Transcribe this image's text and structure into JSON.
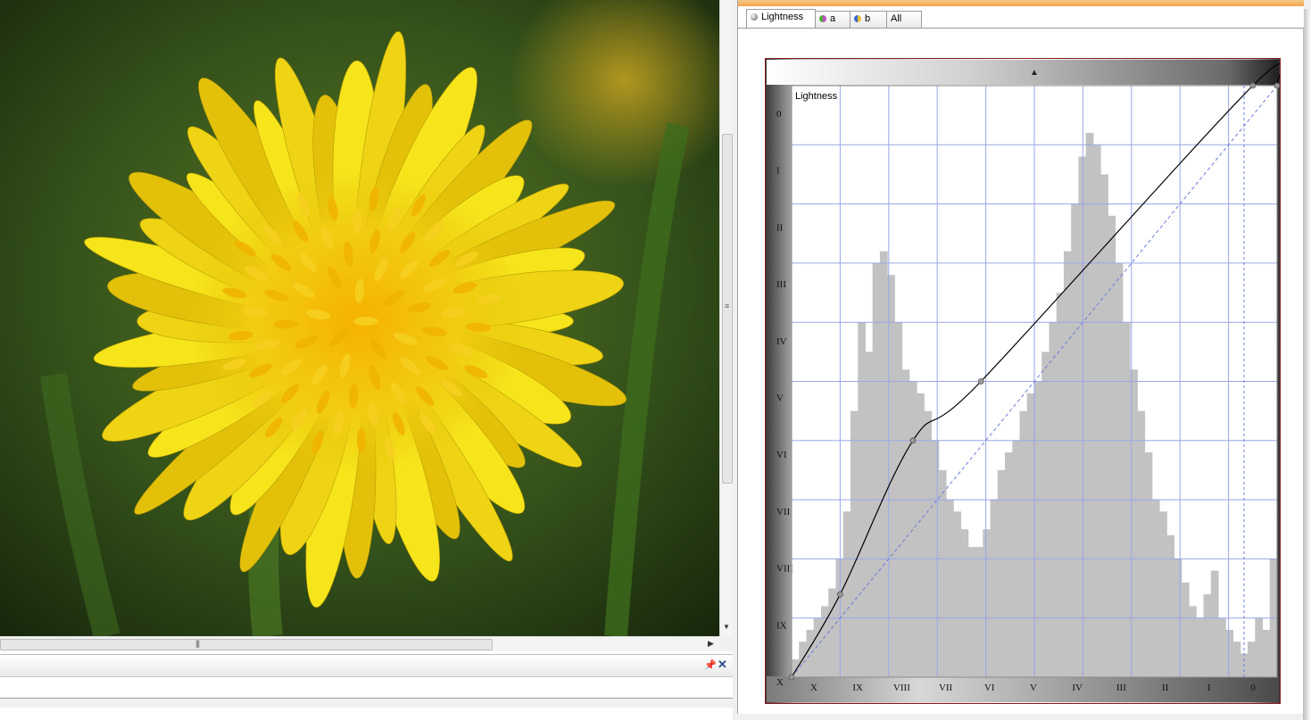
{
  "curves_panel": {
    "tabs": [
      {
        "label": "Lightness",
        "icon": "lightness-channel-icon",
        "color": "#6a6a6a",
        "active": true
      },
      {
        "label": "a",
        "icon": "a-channel-icon",
        "color": "#c04fc0",
        "active": false
      },
      {
        "label": "b",
        "icon": "b-channel-icon",
        "color": "#4fae3a",
        "active": false
      },
      {
        "label": "All",
        "icon": "",
        "color": "",
        "active": false
      }
    ],
    "graph": {
      "title": "Lightness",
      "y_tick_labels": [
        "0",
        "I",
        "II",
        "III",
        "IV",
        "V",
        "VI",
        "VII",
        "VIII",
        "IX",
        "X"
      ],
      "x_tick_labels": [
        "X",
        "IX",
        "VIII",
        "VII",
        "VI",
        "V",
        "IV",
        "III",
        "II",
        "I",
        "0"
      ],
      "grid_color": "#9aa6e8",
      "histogram_color": "#c2c2c2"
    }
  },
  "chart_data": {
    "type": "line",
    "title": "Lightness",
    "x_range": [
      0,
      100
    ],
    "y_range": [
      0,
      100
    ],
    "series": [
      {
        "kind": "curve",
        "control_points": [
          [
            0,
            0
          ],
          [
            10,
            14
          ],
          [
            25,
            40
          ],
          [
            39,
            50
          ],
          [
            95,
            100
          ],
          [
            100,
            100
          ]
        ]
      },
      {
        "kind": "identity-reference",
        "control_points": [
          [
            0,
            0
          ],
          [
            100,
            100
          ]
        ]
      }
    ],
    "histogram": [
      3,
      6,
      8,
      10,
      12,
      15,
      20,
      28,
      45,
      60,
      55,
      70,
      72,
      68,
      60,
      52,
      50,
      48,
      45,
      40,
      35,
      30,
      28,
      25,
      22,
      22,
      25,
      30,
      35,
      38,
      40,
      45,
      48,
      50,
      55,
      60,
      65,
      72,
      80,
      88,
      92,
      90,
      85,
      78,
      70,
      60,
      52,
      45,
      38,
      30,
      28,
      24,
      20,
      16,
      12,
      10,
      14,
      18,
      10,
      8,
      6,
      4,
      6,
      10,
      8,
      20
    ],
    "grid": true
  },
  "colors": {
    "accent_orange": "#f3a64a",
    "frame_border": "#8a1a1a"
  },
  "photo": {
    "subject": "yellow-dandelion-flower"
  }
}
